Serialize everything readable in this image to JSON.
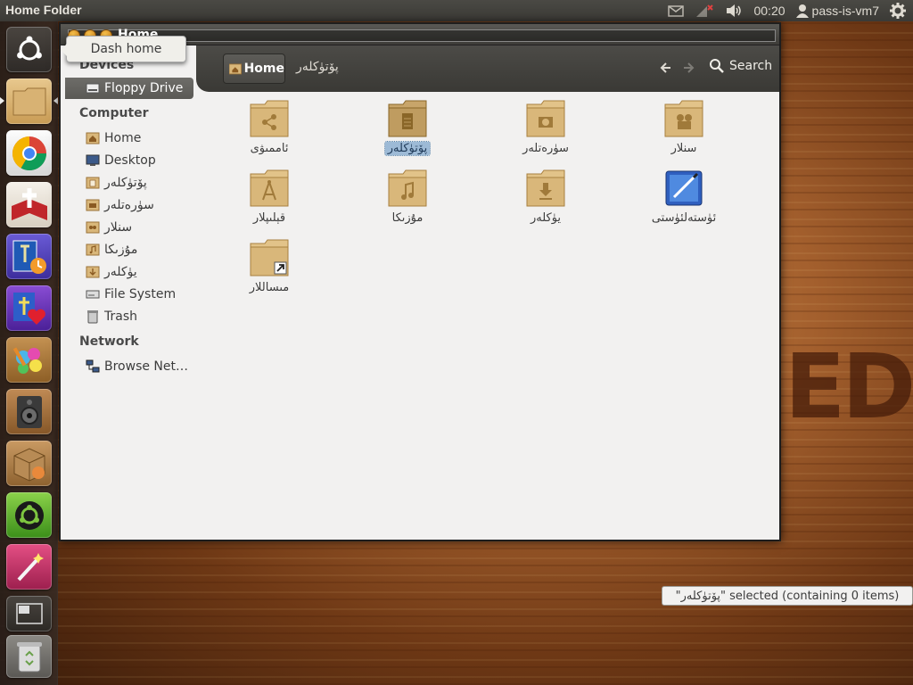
{
  "top_panel": {
    "app_title": "Home Folder",
    "clock": "00:20",
    "user": "pass-is-vm7",
    "icons": [
      "mail-icon",
      "network-icon",
      "volume-icon",
      "user-icon",
      "gear-icon"
    ]
  },
  "launcher": {
    "tooltip": "Dash home",
    "items": [
      "dash-home",
      "files",
      "chrome",
      "bible-reader",
      "bible-study",
      "christian-app",
      "paint",
      "speaker",
      "package-installer",
      "ubuntu-software",
      "magic-wand",
      "workspace-switcher",
      "trash"
    ]
  },
  "window": {
    "title": "Home"
  },
  "sidebar": {
    "devices_heading": "Devices",
    "floppy": "Floppy Drive",
    "computer_heading": "Computer",
    "computer_items": [
      "Home",
      "Desktop",
      "پۆتۈكلەر",
      "سۈرەتلەر",
      "سنلار",
      "مۇزىكا",
      "يۈكلەر",
      "File System",
      "Trash"
    ],
    "network_heading": "Network",
    "network_item": "Browse Net…"
  },
  "toolbar": {
    "crumb_home": "Home",
    "crumb_current": "پۆتۈكلەر",
    "search": "Search"
  },
  "content": {
    "items": [
      {
        "label": "ئاممىۋى",
        "emblem": "share-icon"
      },
      {
        "label": "پۆتۈكلەر",
        "emblem": "document-icon"
      },
      {
        "label": "سۈرەتلەر",
        "emblem": "camera-icon"
      },
      {
        "label": "سنلار",
        "emblem": "video-icon"
      },
      {
        "label": "قېلىپلار",
        "emblem": "template-icon"
      },
      {
        "label": "مۇزىكا",
        "emblem": "music-icon"
      },
      {
        "label": "يۈكلەر",
        "emblem": "download-icon"
      },
      {
        "label": "ئۈستەلئۈستى",
        "emblem": "desktop-file-icon"
      },
      {
        "label": "مىساللار",
        "emblem": "link-icon"
      }
    ]
  },
  "status": {
    "text": "\"پۆتۈكلەر\" selected (containing 0 items)"
  },
  "wallpaper_text": "ED",
  "colors": {
    "folder": "#d9b77a",
    "selection": "#9dbad6",
    "panel": "#3b3a36",
    "accent_orange": "#e9893b"
  }
}
